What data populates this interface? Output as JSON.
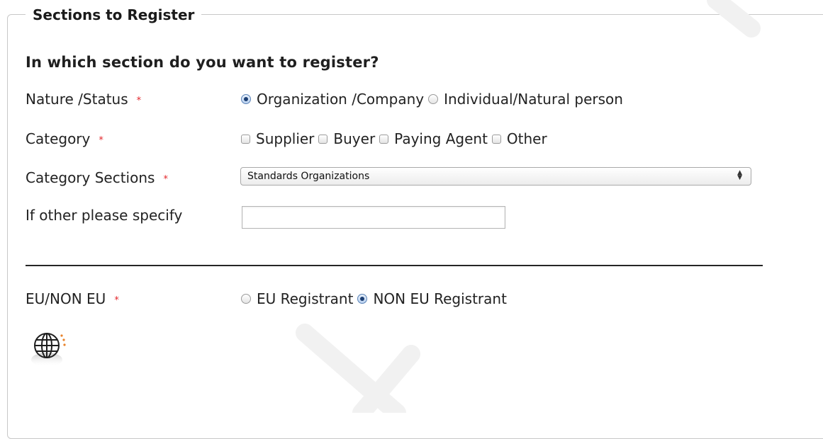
{
  "fieldset": {
    "legend": "Sections to Register",
    "question": "In which section do you want to register?"
  },
  "nature": {
    "label": "Nature /Status",
    "options": [
      "Organization /Company",
      "Individual/Natural person"
    ],
    "selected": "Organization /Company"
  },
  "category": {
    "label": "Category",
    "options": [
      "Supplier",
      "Buyer",
      "Paying Agent",
      "Other"
    ]
  },
  "category_sections": {
    "label": "Category Sections",
    "value": "Standards Organizations"
  },
  "other": {
    "label": "If other please specify",
    "value": ""
  },
  "eu": {
    "label": "EU/NON EU",
    "options": [
      "EU Registrant",
      "NON EU Registrant"
    ],
    "selected": "NON EU Registrant"
  },
  "required_marker": "*",
  "colors": {
    "required": "#e3262b",
    "radio_selected": "#1c3f74",
    "border": "#c8c8c8"
  },
  "icons": [
    "globe-icon"
  ]
}
